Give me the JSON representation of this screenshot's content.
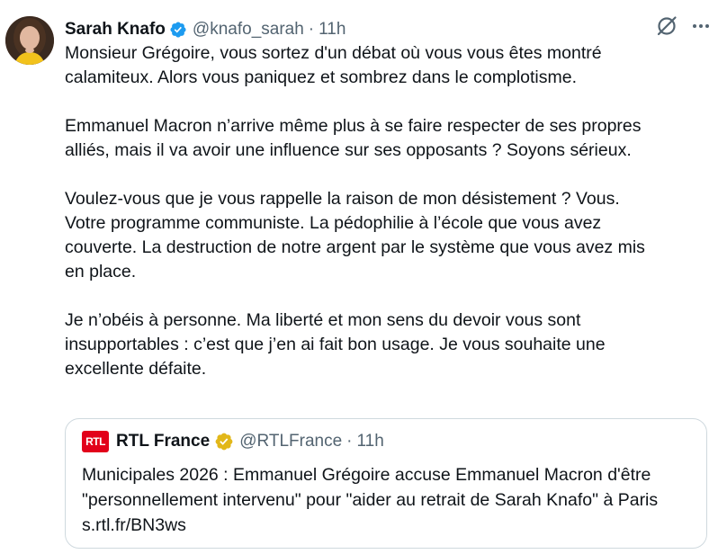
{
  "tweet": {
    "author_name": "Sarah Knafo",
    "handle": "@knafo_sarah",
    "separator": "·",
    "time": "11h",
    "text": "Monsieur Grégoire, vous sortez d'un débat où vous vous êtes montré\ncalamiteux. Alors vous paniquez et sombrez dans le complotisme.\n\nEmmanuel Macron n’arrive même plus à se faire respecter de ses propres\nalliés, mais il va avoir une influence sur ses opposants ? Soyons sérieux.\n\nVoulez-vous que je vous rappelle la raison de mon désistement ? Vous.\nVotre programme communiste. La pédophilie à l’école que vous avez\ncouverte. La destruction de notre argent par le système que vous avez mis\nen place.\n\nJe n’obéis à personne. Ma liberté et mon sens du devoir vous sont\ninsupportables : c’est que j’en ai fait bon usage. Je vous souhaite une\nexcellente défaite."
  },
  "quoted": {
    "logo_text": "RTL",
    "author_name": "RTL France",
    "handle": "@RTLFrance",
    "separator": "·",
    "time": "11h",
    "text": "Municipales 2026 : Emmanuel Grégoire accuse Emmanuel Macron d'être \"personnellement intervenu\" pour \"aider au retrait de Sarah Knafo\" à Paris s.rtl.fr/BN3ws"
  },
  "icons": {
    "verified": "verified-badge-blue",
    "quote_verified": "verified-badge-gold",
    "grok": "grok-icon",
    "more": "more-icon"
  },
  "colors": {
    "text": "#0f1419",
    "secondary": "#536471",
    "verified_blue": "#1d9bf0",
    "verified_gold": "#e2b719",
    "rtl_red": "#e2001a",
    "border": "#cfd9de"
  }
}
